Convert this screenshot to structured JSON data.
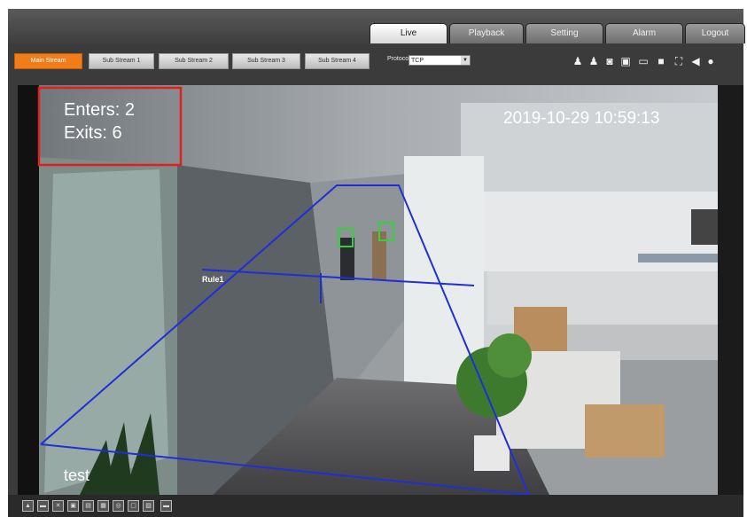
{
  "tabs": [
    {
      "label": "Live",
      "active": true
    },
    {
      "label": "Playback"
    },
    {
      "label": "Setting"
    },
    {
      "label": "Alarm"
    },
    {
      "label": "Logout"
    }
  ],
  "streams": {
    "main": "Main Stream",
    "sub1": "Sub Stream 1",
    "sub2": "Sub Stream 2",
    "sub3": "Sub Stream 3",
    "sub4": "Sub Stream 4",
    "protocol_label": "Protocol",
    "protocol_value": "TCP"
  },
  "toolbar_icons": [
    "user-icon",
    "users-icon",
    "snapshot-icon",
    "record-icon",
    "fullscreen-icon",
    "camera-icon",
    "zoom-icon",
    "audio-icon",
    "mic-icon"
  ],
  "video": {
    "enters": "Enters: 2",
    "exits": "Exits: 6",
    "timestamp": "2019-10-29 10:59:13",
    "rule_label": "Rule1",
    "channel_name": "test",
    "highlight_color": "#e0201b",
    "rule_color": "#1f2fd8",
    "detect_color": "#31d33a"
  },
  "bottom_icons": [
    "restore-icon",
    "ratio-icon",
    "zoom-icon",
    "ptz-icon",
    "fisheye-icon",
    "region-icon",
    "fit-icon",
    "grid-icon",
    "fullwin-icon",
    "close-icon"
  ],
  "colors": {
    "accent": "#f07d1a"
  }
}
